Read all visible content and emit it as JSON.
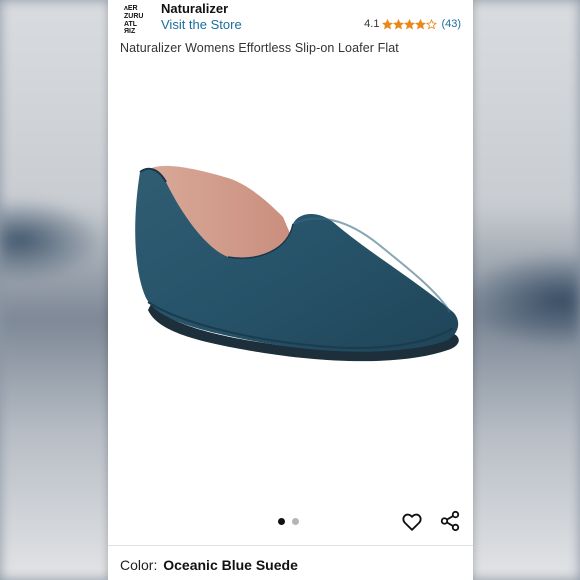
{
  "store": {
    "brand": "Naturalizer",
    "link_label": "Visit the Store",
    "logo_text": "NATURALIZER"
  },
  "rating": {
    "value": "4.1",
    "stars": 4.1,
    "count": "(43)"
  },
  "product": {
    "title": "Naturalizer Womens Effortless Slip-on Loafer Flat"
  },
  "gallery": {
    "current_index": 1,
    "total": 2
  },
  "actions": {
    "favorite_icon": "heart-icon",
    "share_icon": "share-icon"
  },
  "color": {
    "label": "Color:",
    "value": "Oceanic Blue Suede"
  },
  "theme": {
    "star_color": "#e8891c",
    "link_color": "#1a6e9e",
    "shoe_color": "#2a5568"
  }
}
